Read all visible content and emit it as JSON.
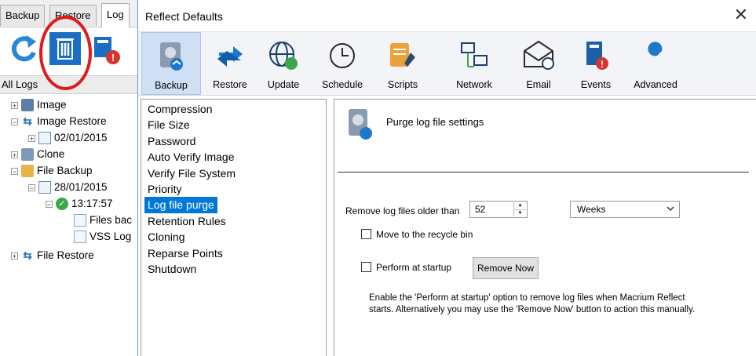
{
  "left_pane": {
    "tabs": [
      "Backup",
      "Restore",
      "Log"
    ],
    "active_tab": "Log",
    "all_logs": "All Logs",
    "tree": [
      {
        "label": "Image"
      },
      {
        "label": "Image Restore"
      },
      {
        "label": "02/01/2015"
      },
      {
        "label": "Clone"
      },
      {
        "label": "File Backup"
      },
      {
        "label": "28/01/2015"
      },
      {
        "label": "13:17:57"
      },
      {
        "label": "Files bac"
      },
      {
        "label": "VSS Log"
      },
      {
        "label": "File Restore"
      }
    ]
  },
  "dialog": {
    "title": "Reflect Defaults",
    "close": "✕",
    "ribbon": [
      {
        "label": "Backup",
        "icon": "backup-disk-icon",
        "selected": true
      },
      {
        "label": "Restore",
        "icon": "restore-arrows-icon"
      },
      {
        "label": "Update",
        "icon": "update-globe-icon"
      },
      {
        "label": "Schedule",
        "icon": "schedule-clock-icon"
      },
      {
        "label": "Scripts",
        "icon": "scripts-scroll-icon"
      },
      {
        "label": "Network",
        "icon": "network-computers-icon"
      },
      {
        "label": "Email",
        "icon": "email-envelope-icon"
      },
      {
        "label": "Events",
        "icon": "events-book-icon"
      },
      {
        "label": "Advanced",
        "icon": "advanced-wrench-icon"
      }
    ],
    "categories": [
      "Compression",
      "File Size",
      "Password",
      "Auto Verify Image",
      "Verify File System",
      "Priority",
      "Log file purge",
      "Retention Rules",
      "Cloning",
      "Reparse Points",
      "Shutdown"
    ],
    "selected_category": "Log file purge",
    "settings": {
      "header": "Purge log file settings",
      "remove_label": "Remove log files older than",
      "remove_value": "52",
      "unit_value": "Weeks",
      "recycle_label": "Move to the recycle bin",
      "startup_label": "Perform at startup",
      "remove_now": "Remove Now",
      "desc_line1": "Enable the 'Perform at startup' option to remove log files when Macrium Reflect",
      "desc_line2": "starts. Alternatively you may use the 'Remove Now' button to action this manually."
    }
  },
  "colors": {
    "accent": "#0078d7",
    "ribbon_selected": "#cfe0f5",
    "annotation": "#e01b1b"
  }
}
